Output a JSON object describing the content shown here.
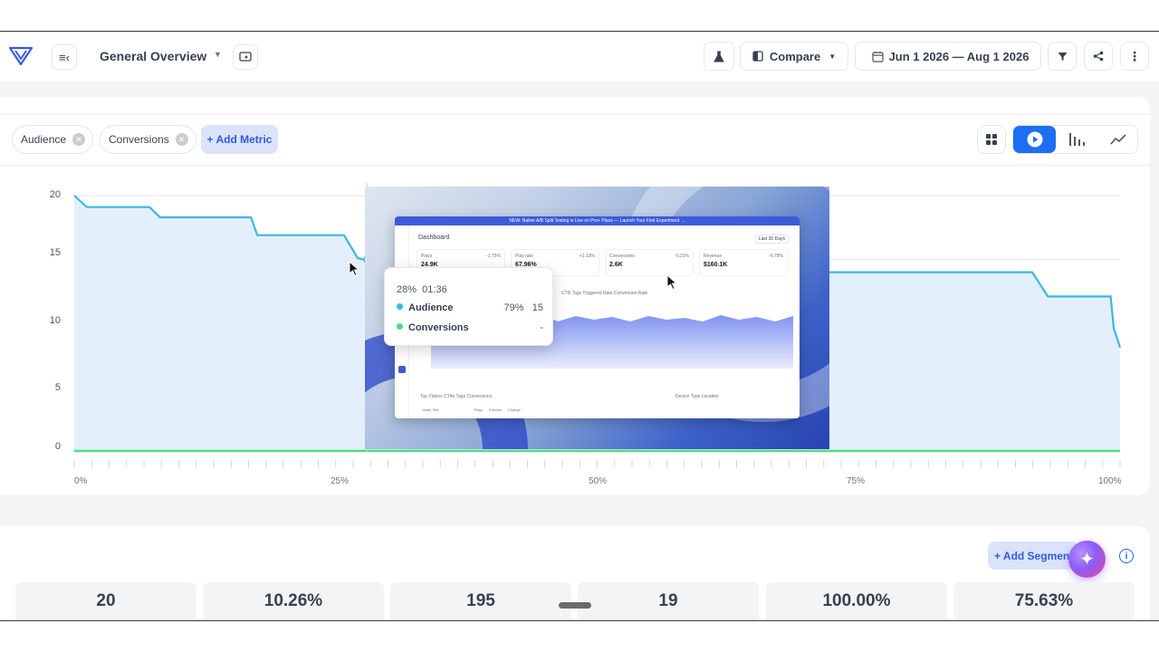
{
  "header": {
    "title": "General Overview",
    "compare_label": "Compare",
    "date_range": "Jun 1 2026 — Aug 1 2026"
  },
  "metrics": {
    "chips": [
      "Audience",
      "Conversions"
    ],
    "add_metric_label": "+ Add Metric"
  },
  "chart_data": {
    "type": "area",
    "x_label_format": "percent",
    "xlim": [
      0,
      100
    ],
    "ylim": [
      0,
      20
    ],
    "y_ticks": [
      "20",
      "15",
      "10",
      "5",
      "0"
    ],
    "x_ticks": [
      "0%",
      "25%",
      "50%",
      "75%",
      "100%"
    ],
    "series": [
      {
        "name": "Audience",
        "color": "#3bb8e0",
        "x": [
          0,
          1.2,
          7.2,
          8.2,
          16.9,
          17.5,
          25.8,
          27.1,
          27.6,
          68.5,
          69.5,
          91.6,
          93.1,
          99.1,
          99.4,
          100
        ],
        "y": [
          20,
          19.1,
          19.1,
          18.3,
          18.3,
          16.9,
          16.9,
          15.1,
          15,
          15,
          14,
          14,
          12.1,
          12.1,
          9.6,
          8.1
        ]
      },
      {
        "name": "Conversions",
        "color": "#4ade80",
        "x": [
          0,
          100
        ],
        "y": [
          0,
          0
        ]
      }
    ]
  },
  "tooltip": {
    "position": "28%",
    "time": "01:36",
    "rows": [
      {
        "name": "Audience",
        "pct": "79%",
        "value": "15",
        "color": "#3bb8e0"
      },
      {
        "name": "Conversions",
        "pct": "",
        "value": "-",
        "color": "#4ade80"
      }
    ]
  },
  "video_preview": {
    "banner": "NEW: Native A/B Split Testing is Live on Pro+ Plans — Launch Your First Experiment →",
    "title": "Dashboard",
    "range": "Last 30 Days",
    "stats": [
      {
        "label": "Plays",
        "value": "24.9K",
        "delta": "-1.75%"
      },
      {
        "label": "Play rate",
        "value": "67.96%",
        "delta": "+1.13%"
      },
      {
        "label": "Conversions",
        "value": "2.6K",
        "delta": "-5.31%"
      },
      {
        "label": "Revenue",
        "value": "$160.1K",
        "delta": "-6.78%"
      }
    ],
    "metric_tabs": "CTR     Tags Triggered Rate     Conversion Rate",
    "bottom_tabs_left": "Top Videos    CTAs    Tags    Conversions",
    "bottom_tabs_right": "Device Type    Location",
    "table_headers": "Video Title                                   Plays      Preview      Change"
  },
  "segments": {
    "add_segment_label": "+ Add Segment",
    "info_icon": "info-icon",
    "ai_icon": "sparkle-icon"
  },
  "stats": [
    "20",
    "10.26%",
    "195",
    "19",
    "100.00%",
    "75.63%"
  ],
  "colors": {
    "accent": "#1d6ef3",
    "audience": "#3bb8e0",
    "conversions": "#4ade80"
  }
}
